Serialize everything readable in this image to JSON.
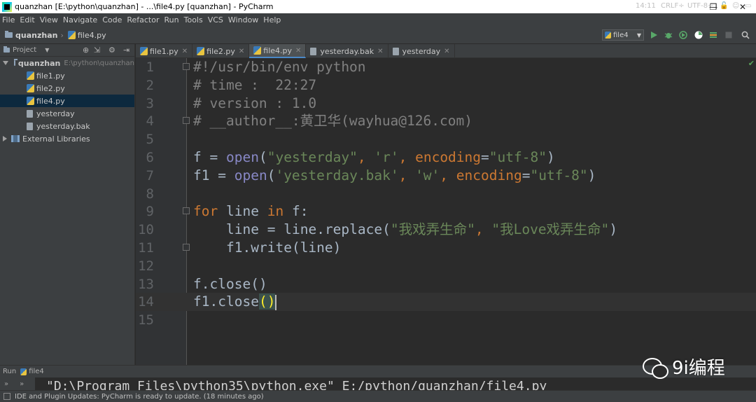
{
  "window": {
    "title": "quanzhan [E:\\python\\quanzhan] - ...\\file4.py [quanzhan] - PyCharm",
    "minimize": "—",
    "maximize": "❐",
    "close": "✕"
  },
  "menu": [
    "File",
    "Edit",
    "View",
    "Navigate",
    "Code",
    "Refactor",
    "Run",
    "Tools",
    "VCS",
    "Window",
    "Help"
  ],
  "breadcrumb": {
    "project": "quanzhan",
    "file": "file4.py"
  },
  "run_config": {
    "name": "file4"
  },
  "project_panel": {
    "title": "Project",
    "root": {
      "name": "quanzhan",
      "path": "E:\\python\\quanzhan"
    },
    "files": [
      {
        "name": "file1.py",
        "type": "py"
      },
      {
        "name": "file2.py",
        "type": "py"
      },
      {
        "name": "file4.py",
        "type": "py",
        "selected": true
      },
      {
        "name": "yesterday",
        "type": "txt"
      },
      {
        "name": "yesterday.bak",
        "type": "txt"
      }
    ],
    "libraries": "External Libraries"
  },
  "tabs": [
    {
      "label": "file1.py",
      "type": "py"
    },
    {
      "label": "file2.py",
      "type": "py"
    },
    {
      "label": "file4.py",
      "type": "py",
      "active": true
    },
    {
      "label": "yesterday.bak",
      "type": "txt"
    },
    {
      "label": "yesterday",
      "type": "txt"
    }
  ],
  "code_lines": [
    "#!/usr/bin/env python",
    "# time :  22:27",
    "# version : 1.0",
    "# __author__:黄卫华(wayhua@126.com)",
    "",
    "f = open(\"yesterday\", 'r', encoding=\"utf-8\")",
    "f1 = open('yesterday.bak', 'w', encoding=\"utf-8\")",
    "",
    "for line in f:",
    "    line = line.replace(\"我戏弄生命\", \"我Love戏弄生命\")",
    "    f1.write(line)",
    "",
    "f.close()",
    "f1.close()",
    ""
  ],
  "current_line": 14,
  "run_panel": {
    "label": "Run",
    "config": "file4",
    "console_output": "\"D:\\Program Files\\python35\\python.exe\" E:/python/quanzhan/file4.py"
  },
  "status": {
    "message": "IDE and Plugin Updates: PyCharm is ready to update. (18 minutes ago)",
    "position": "14:11",
    "line_sep": "CRLF÷",
    "encoding": "UTF-8÷"
  },
  "watermark": "9i编程",
  "colors": {
    "background": "#2b2b2b",
    "panel": "#3c3f41",
    "keyword": "#cc7832",
    "string": "#6a8759",
    "comment": "#808080",
    "builtin": "#8888c6",
    "text": "#a9b7c6"
  }
}
